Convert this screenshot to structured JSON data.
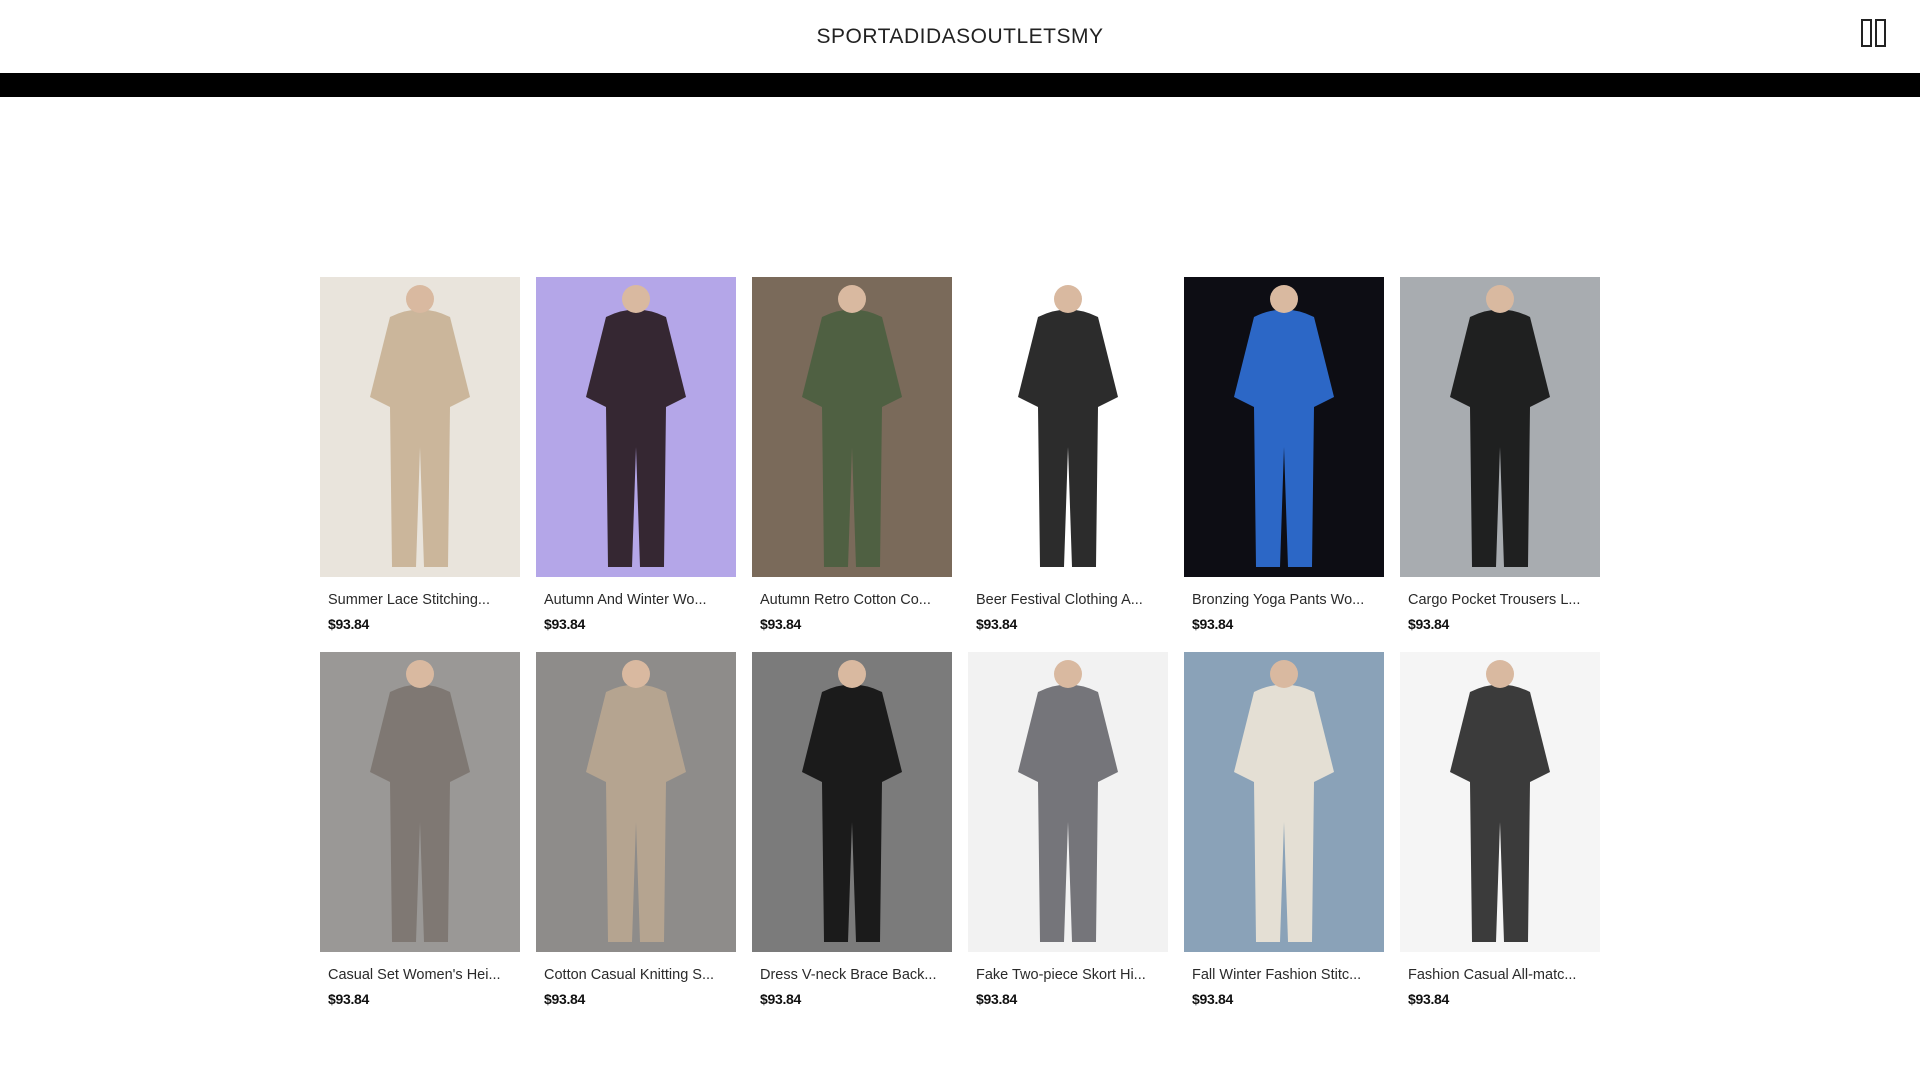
{
  "header": {
    "brand": "SPORTADIDASOUTLETSMY",
    "cart_icon": "book-open-icon"
  },
  "products": [
    {
      "title": "Summer Lace Stitching...",
      "price": "$93.84",
      "image": "beige-lace-top-denim-shorts",
      "bg": "#e9e4dc",
      "fg": "#c8b295"
    },
    {
      "title": "Autumn And Winter Wo...",
      "price": "$93.84",
      "image": "dark-tights-lavender-bg",
      "bg": "#b4a6e8",
      "fg": "#2a1c22"
    },
    {
      "title": "Autumn Retro Cotton Co...",
      "price": "$93.84",
      "image": "green-knit-vest",
      "bg": "#7a6a5a",
      "fg": "#4b6040"
    },
    {
      "title": "Beer Festival Clothing A...",
      "price": "$93.84",
      "image": "oktoberfest-costume",
      "bg": "#ffffff",
      "fg": "#1a1a1a"
    },
    {
      "title": "Bronzing Yoga Pants Wo...",
      "price": "$93.84",
      "image": "blue-marble-leggings",
      "bg": "#0d0d14",
      "fg": "#2f6fd6"
    },
    {
      "title": "Cargo Pocket Trousers L...",
      "price": "$93.84",
      "image": "black-cargo-trousers",
      "bg": "#a8acb0",
      "fg": "#141414"
    },
    {
      "title": "Casual Set Women's Hei...",
      "price": "$93.84",
      "image": "argyle-sweater-set",
      "bg": "#9a9896",
      "fg": "#7d7570"
    },
    {
      "title": "Cotton Casual Knitting S...",
      "price": "$93.84",
      "image": "knit-hoodie-sets",
      "bg": "#8e8c8a",
      "fg": "#b9a690"
    },
    {
      "title": "Dress V-neck Brace Back...",
      "price": "$93.84",
      "image": "black-sequin-gown",
      "bg": "#7b7b7b",
      "fg": "#121212"
    },
    {
      "title": "Fake Two-piece Skort Hi...",
      "price": "$93.84",
      "image": "grey-skort-flare-pants",
      "bg": "#f2f2f2",
      "fg": "#6a6a70"
    },
    {
      "title": "Fall Winter Fashion Stitc...",
      "price": "$93.84",
      "image": "cream-oversized-sweatshirt",
      "bg": "#8aa2b8",
      "fg": "#ece4d6"
    },
    {
      "title": "Fashion Casual All-matc...",
      "price": "$93.84",
      "image": "black-marble-print-top",
      "bg": "#f5f5f5",
      "fg": "#2a2a2a"
    }
  ]
}
